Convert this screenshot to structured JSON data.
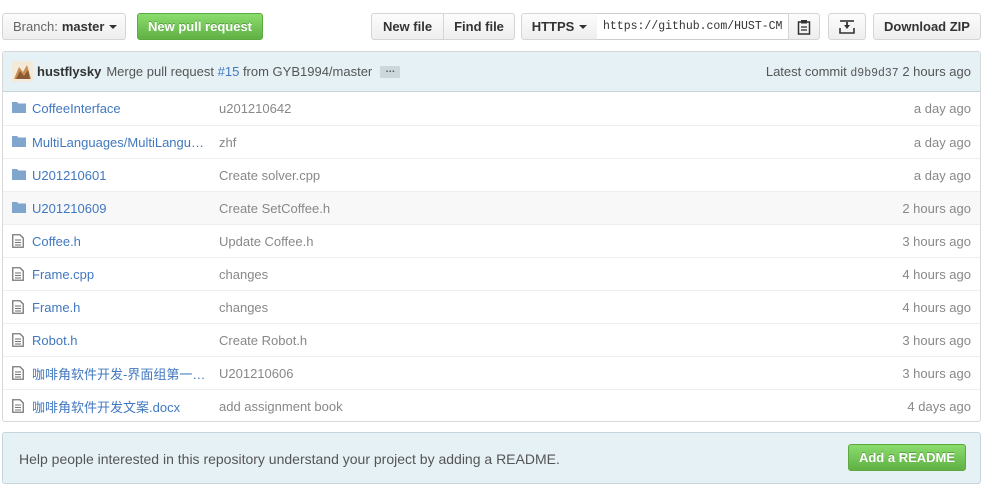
{
  "toolbar": {
    "branch_label": "Branch:",
    "branch_value": "master",
    "new_pr": "New pull request",
    "new_file": "New file",
    "find_file": "Find file",
    "protocol": "HTTPS",
    "clone_url": "https://github.com/HUST-CMC",
    "clipboard_icon": "clipboard-icon",
    "download_icon": "download-icon",
    "download_zip": "Download ZIP"
  },
  "commit": {
    "author": "hustflysky",
    "message_prefix": "Merge pull request",
    "pr_number": "#15",
    "message_suffix": "from GYB1994/master",
    "ellipsis": "…",
    "latest_label": "Latest commit",
    "sha": "d9b9d37",
    "age": "2 hours ago"
  },
  "files": [
    {
      "type": "folder",
      "name": "CoffeeInterface",
      "message": "u201210642",
      "age": "a day ago"
    },
    {
      "type": "folder",
      "name": "MultiLanguages/MultiLangu…",
      "message": "zhf",
      "age": "a day ago"
    },
    {
      "type": "folder",
      "name": "U201210601",
      "message": "Create solver.cpp",
      "age": "a day ago"
    },
    {
      "type": "folder",
      "name": "U201210609",
      "message": "Create SetCoffee.h",
      "age": "2 hours ago"
    },
    {
      "type": "file",
      "name": "Coffee.h",
      "message": "Update Coffee.h",
      "age": "3 hours ago"
    },
    {
      "type": "file",
      "name": "Frame.cpp",
      "message": "changes",
      "age": "4 hours ago"
    },
    {
      "type": "file",
      "name": "Frame.h",
      "message": "changes",
      "age": "4 hours ago"
    },
    {
      "type": "file",
      "name": "Robot.h",
      "message": "Create Robot.h",
      "age": "3 hours ago"
    },
    {
      "type": "file",
      "name": "咖啡角软件开发-界面组第一…",
      "message": "U201210606",
      "age": "3 hours ago"
    },
    {
      "type": "file",
      "name": "咖啡角软件开发文案.docx",
      "message": "add assignment book",
      "age": "4 days ago"
    }
  ],
  "readme": {
    "text": "Help people interested in this repository understand your project by adding a README.",
    "button": "Add a README"
  },
  "colors": {
    "link": "#4078c0",
    "green": "#60b044",
    "commit_bg": "#e6f1f6",
    "folder": "#80a6cd"
  }
}
